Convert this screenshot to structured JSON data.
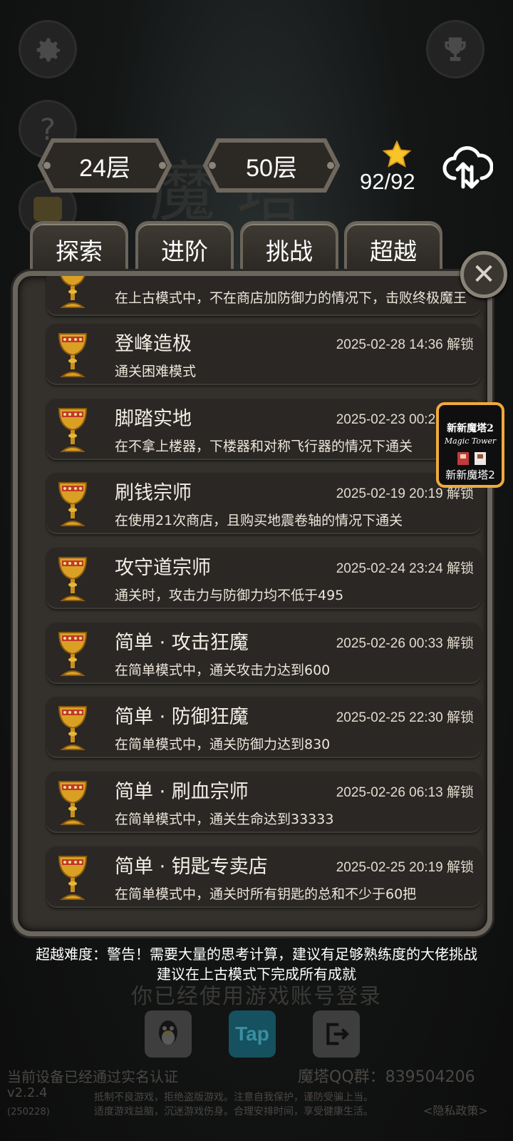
{
  "header": {
    "current_floor": "24层",
    "max_floor": "50层",
    "star_count": "92/92",
    "bg_title": "魔塔"
  },
  "tabs": [
    {
      "label": "探索"
    },
    {
      "label": "进阶"
    },
    {
      "label": "挑战"
    },
    {
      "label": "超越"
    }
  ],
  "achievements": [
    {
      "name": "",
      "date": "",
      "desc": "在上古模式中，不在商店加防御力的情况下，击败终极魔王"
    },
    {
      "name": "登峰造极",
      "date": "2025-02-28 14:36 解锁",
      "desc": "通关困难模式"
    },
    {
      "name": "脚踏实地",
      "date": "2025-02-23 00:26 解锁",
      "desc": "在不拿上楼器，下楼器和对称飞行器的情况下通关"
    },
    {
      "name": "刷钱宗师",
      "date": "2025-02-19 20:19 解锁",
      "desc": "在使用21次商店，且购买地震卷轴的情况下通关"
    },
    {
      "name": "攻守道宗师",
      "date": "2025-02-24 23:24 解锁",
      "desc": "通关时，攻击力与防御力均不低于495"
    },
    {
      "name": "简单 · 攻击狂魔",
      "date": "2025-02-26 00:33 解锁",
      "desc": "在简单模式中，通关攻击力达到600"
    },
    {
      "name": "简单 · 防御狂魔",
      "date": "2025-02-25 22:30 解锁",
      "desc": "在简单模式中，通关防御力达到830"
    },
    {
      "name": "简单 · 刷血宗师",
      "date": "2025-02-26 06:13 解锁",
      "desc": "在简单模式中，通关生命达到33333"
    },
    {
      "name": "简单 · 钥匙专卖店",
      "date": "2025-02-25 20:19 解锁",
      "desc": "在简单模式中，通关时所有钥匙的总和不少于60把"
    }
  ],
  "ad_badge": {
    "title_cn": "新新魔塔2",
    "title_en": "Magic Tower",
    "caption": "新新魔塔2"
  },
  "info": {
    "warning_line1": "超越难度：警告！需要大量的思考计算，建议有足够熟练度的大佬挑战",
    "warning_line2": "建议在上古模式下完成所有成就",
    "login_hint": "你已经使用游戏账号登录"
  },
  "login_buttons": {
    "tap_label": "Tap"
  },
  "footer": {
    "realname": "当前设备已经通过实名认证",
    "qq_group": "魔塔QQ群：839504206",
    "version": "v2.2.4",
    "build": "(250228)",
    "health_line1": "抵制不良游戏，拒绝盗版游戏。注意自我保护，谨防受骗上当。",
    "health_line2": "适度游戏益脑，沉迷游戏伤身。合理安排时间，享受健康生活。",
    "privacy": "<隐私政策>"
  },
  "colors": {
    "panel_bg": "#34312c",
    "panel_border": "#6a655d",
    "item_bg": "#2a2724",
    "star": "#f7c42a",
    "badge_border": "#f1a93c",
    "tap_blue": "#19b6d8"
  }
}
